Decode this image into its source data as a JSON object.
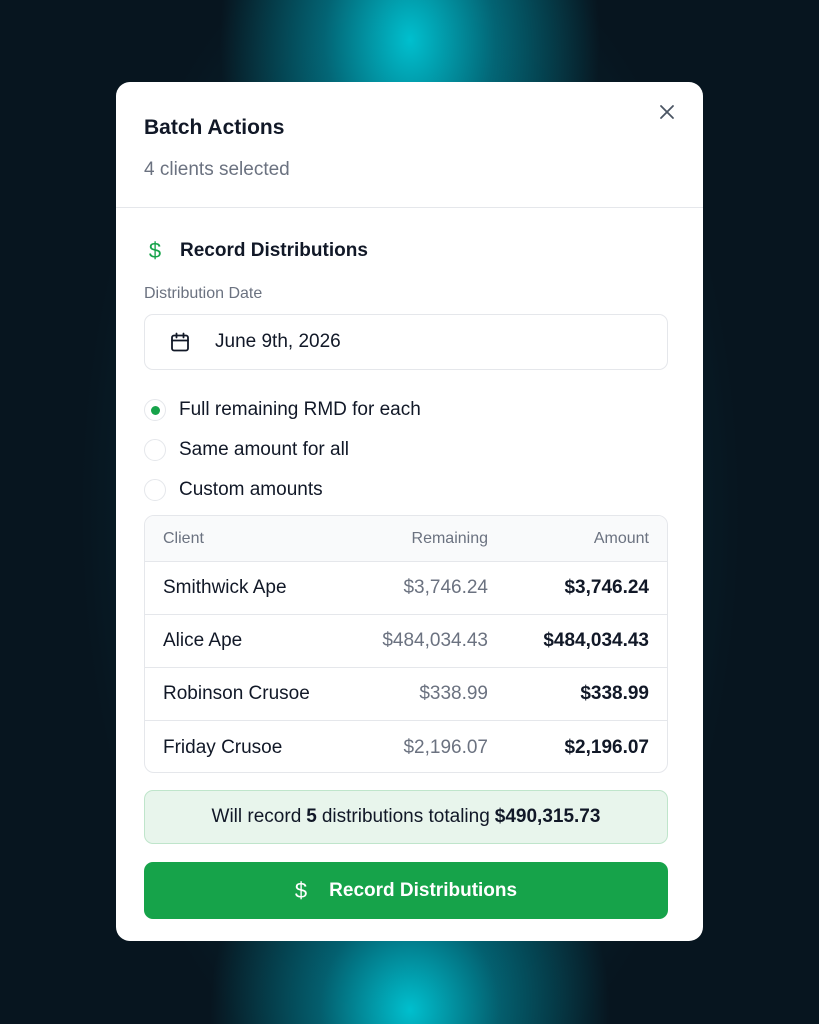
{
  "modal": {
    "title": "Batch Actions",
    "subtitle": "4 clients selected",
    "close_icon": "close-icon"
  },
  "section": {
    "icon": "dollar-icon",
    "icon_glyph": "$",
    "title": "Record Distributions"
  },
  "date_field": {
    "label": "Distribution Date",
    "icon": "calendar-icon",
    "value": "June 9th, 2026"
  },
  "options": [
    {
      "label": "Full remaining RMD for each",
      "selected": true
    },
    {
      "label": "Same amount for all",
      "selected": false
    },
    {
      "label": "Custom amounts",
      "selected": false
    }
  ],
  "table": {
    "headers": {
      "client": "Client",
      "remaining": "Remaining",
      "amount": "Amount"
    },
    "rows": [
      {
        "client": "Smithwick Ape",
        "remaining": "$3,746.24",
        "amount": "$3,746.24"
      },
      {
        "client": "Alice Ape",
        "remaining": "$484,034.43",
        "amount": "$484,034.43"
      },
      {
        "client": "Robinson Crusoe",
        "remaining": "$338.99",
        "amount": "$338.99"
      },
      {
        "client": "Friday Crusoe",
        "remaining": "$2,196.07",
        "amount": "$2,196.07"
      }
    ]
  },
  "summary": {
    "prefix": "Will record",
    "count": "5",
    "middle": "distributions totaling",
    "total": "$490,315.73"
  },
  "submit": {
    "icon": "dollar-icon",
    "icon_glyph": "$",
    "label": "Record Distributions"
  },
  "colors": {
    "accent": "#16a34a",
    "summary_bg": "#e8f5ec",
    "muted_text": "#6b7280"
  }
}
